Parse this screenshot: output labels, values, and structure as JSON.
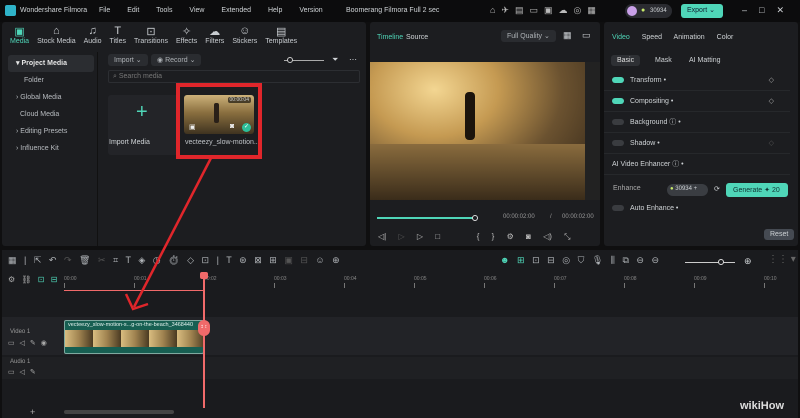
{
  "app": {
    "name": "Wondershare Filmora",
    "project_title": "Boomerang Filmora Full 2 sec",
    "credits": "30934",
    "export_label": "Export"
  },
  "menu": [
    "File",
    "Edit",
    "Tools",
    "View",
    "Extended",
    "Help",
    "Version"
  ],
  "media_tabs": [
    "Media",
    "Stock Media",
    "Audio",
    "Titles",
    "Transitions",
    "Effects",
    "Filters",
    "Stickers",
    "Templates"
  ],
  "media_tab_icons": [
    "▣",
    "⌂",
    "♫",
    "T",
    "⊡",
    "✧",
    "☁",
    "☺",
    "▤"
  ],
  "sidebar": [
    "Project Media",
    "Folder",
    "Global Media",
    "Cloud Media",
    "Editing Presets",
    "Influence Kit"
  ],
  "media_toolbar": {
    "import": "Import",
    "record": "Record",
    "search_placeholder": "Search media"
  },
  "media_items": {
    "import_label": "Import Media",
    "clip_name": "vecteezy_slow-motion...",
    "clip_duration": "00:00:04"
  },
  "preview": {
    "tabs": [
      "Timeline",
      "Source"
    ],
    "quality": "Full Quality",
    "current_time": "00:00:02:00",
    "separator": "/",
    "total_time": "00:00:02:00",
    "progress": 1.0
  },
  "props": {
    "tabs": [
      "Video",
      "Speed",
      "Animation",
      "Color"
    ],
    "subtabs": [
      "Basic",
      "Mask",
      "AI Matting"
    ],
    "rows": [
      {
        "label": "Transform",
        "on": true
      },
      {
        "label": "Compositing",
        "on": true
      },
      {
        "label": "Background",
        "on": false
      },
      {
        "label": "Shadow",
        "on": false
      }
    ],
    "enhancer_title": "AI Video Enhancer",
    "enhance_label": "Enhance",
    "enhance_credits": "30934",
    "generate_label": "Generate",
    "generate_cost": "20",
    "auto_enhance": "Auto Enhance",
    "reset": "Reset"
  },
  "timeline": {
    "ruler": [
      "00:00",
      "00:01",
      "00:02",
      "00:03",
      "00:04",
      "00:05",
      "00:06",
      "00:07",
      "00:08",
      "00:09",
      "00:10"
    ],
    "tracks": [
      "Video 1",
      "Audio 1"
    ],
    "clip_name": "vecteezy_slow-motion-s...g-on-the-beach_3468440"
  },
  "watermark": "wikiHow",
  "colors": {
    "accent": "#4fd6b8",
    "annotation": "#e0262b",
    "playhead": "#f06a6a"
  }
}
